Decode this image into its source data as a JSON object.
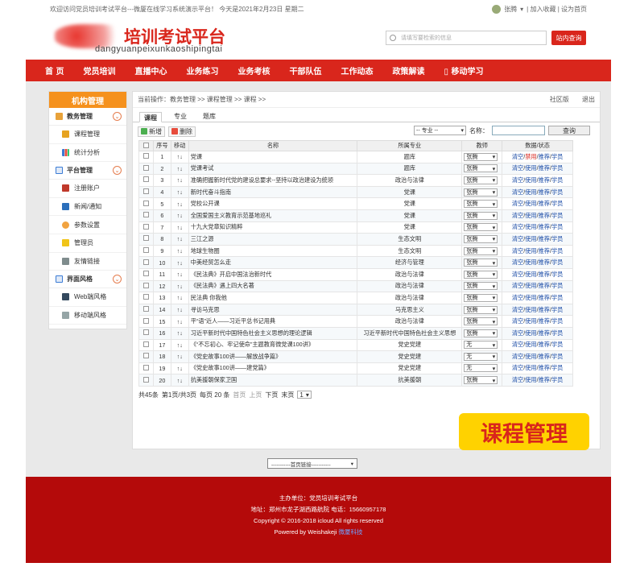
{
  "topbar": {
    "welcome": "欢迎访问党员培训考试平台---微厦在线学习系统演示平台！ 今天是2021年2月23日 星期二",
    "user": "张腾",
    "links": "| 加入收藏 | 设为首页"
  },
  "header": {
    "site_title": "培训考试平台",
    "pinyin": "dangyuanpeixunkaoshipingtai",
    "search_placeholder": "请填写要检索的信息",
    "search_button": "站内查询"
  },
  "nav": [
    "首 页",
    "党员培训",
    "直播中心",
    "业务练习",
    "业务考核",
    "干部队伍",
    "工作动态",
    "政策解读",
    "移动学习"
  ],
  "sidebar": {
    "title": "机构管理",
    "groups": [
      {
        "label": "教务管理",
        "items": [
          "课程管理",
          "统计分析"
        ]
      },
      {
        "label": "平台管理",
        "items": [
          "注册账户",
          "新闻/通知",
          "参数设置",
          "管理员",
          "友情链接"
        ]
      },
      {
        "label": "界面风格",
        "items": [
          "Web端风格",
          "移动端风格"
        ]
      }
    ]
  },
  "main": {
    "breadcrumb": "当前操作：教务管理 >> 课程管理 >> 课程 >>",
    "community": "社区版",
    "logout": "退出",
    "tabs": [
      "课程",
      "专业",
      "题库"
    ],
    "add_button": "新增",
    "delete_button": "删除",
    "major_select": "-- 专业 --",
    "name_label": "名称：",
    "query_button": "查询",
    "columns": [
      "",
      "序号",
      "移动",
      "名称",
      "所属专业",
      "教师",
      "数据/状态"
    ],
    "move_icon": "↑↓",
    "ops": {
      "clear": "清空",
      "disabled": "禁用",
      "enabled": "使用",
      "recommend": "推荐",
      "students": "学员"
    },
    "rows": [
      {
        "no": "1",
        "name": "党课",
        "major": "题库",
        "teacher": "张腾",
        "status": "禁用"
      },
      {
        "no": "2",
        "name": "党课考试",
        "major": "题库",
        "teacher": "张腾",
        "status": "使用"
      },
      {
        "no": "3",
        "name": "准确把握新时代党的建设总要求--坚持以政治建设为统领",
        "major": "政治与法律",
        "teacher": "张腾",
        "status": "使用"
      },
      {
        "no": "4",
        "name": "新时代奋斗指南",
        "major": "党课",
        "teacher": "张腾",
        "status": "使用"
      },
      {
        "no": "5",
        "name": "党校公开课",
        "major": "党课",
        "teacher": "张腾",
        "status": "使用"
      },
      {
        "no": "6",
        "name": "全国爱国主义教育示范基地巡礼",
        "major": "党课",
        "teacher": "张腾",
        "status": "使用"
      },
      {
        "no": "7",
        "name": "十九大党章知识精粹",
        "major": "党课",
        "teacher": "张腾",
        "status": "使用"
      },
      {
        "no": "8",
        "name": "三江之源",
        "major": "生态文明",
        "teacher": "张腾",
        "status": "使用"
      },
      {
        "no": "9",
        "name": "地球生物圈",
        "major": "生态文明",
        "teacher": "张腾",
        "status": "使用"
      },
      {
        "no": "10",
        "name": "中美经贸怎么走",
        "major": "经济与管理",
        "teacher": "张腾",
        "status": "使用"
      },
      {
        "no": "11",
        "name": "《民法典》开启中国法治新时代",
        "major": "政治与法律",
        "teacher": "张腾",
        "status": "使用"
      },
      {
        "no": "12",
        "name": "《民法典》遇上四大名著",
        "major": "政治与法律",
        "teacher": "张腾",
        "status": "使用"
      },
      {
        "no": "13",
        "name": "民法典 你我他",
        "major": "政治与法律",
        "teacher": "张腾",
        "status": "使用"
      },
      {
        "no": "14",
        "name": "寻访马克思",
        "major": "马克思主义",
        "teacher": "张腾",
        "status": "使用"
      },
      {
        "no": "15",
        "name": "平“语”近人——习近平总书记用典",
        "major": "政治与法律",
        "teacher": "张腾",
        "status": "使用"
      },
      {
        "no": "16",
        "name": "习近平新时代中国特色社会主义思想的理论逻辑",
        "major": "习近平新时代中国特色社会主义思想",
        "teacher": "张腾",
        "status": "使用"
      },
      {
        "no": "17",
        "name": "《“不忘初心、牢记使命”主题教育微党课100讲》",
        "major": "党史党建",
        "teacher": "无",
        "status": "使用"
      },
      {
        "no": "18",
        "name": "《党史故事100讲——解放战争篇》",
        "major": "党史党建",
        "teacher": "无",
        "status": "使用"
      },
      {
        "no": "19",
        "name": "《党史故事100讲——建党篇》",
        "major": "党史党建",
        "teacher": "无",
        "status": "使用"
      },
      {
        "no": "20",
        "name": "抗美援朝保家卫国",
        "major": "抗美援朝",
        "teacher": "张腾",
        "status": "使用"
      }
    ],
    "pager": {
      "total": "共45条",
      "page": "第1页/共3页",
      "size": "每页 20 条",
      "first": "首页",
      "prev": "上页",
      "next": "下页",
      "last": "末页",
      "current": "1"
    }
  },
  "badge": "课程管理",
  "link_select": "-----------首页链接-----------",
  "footer": {
    "org": "主办单位：党员培训考试平台",
    "address": "地址：郑州市龙子湖西路航院   电话：15660957178",
    "copyright": "Copyright © 2016-2018 icloud All rights reserved",
    "powered": "Powered by Weishakeji",
    "powered_link": "微厦科技"
  },
  "colors": {
    "brand_red": "#d9261c",
    "sidebar_orange": "#f5911d",
    "footer_red": "#b40a0a",
    "badge_yellow": "#ffd200"
  }
}
